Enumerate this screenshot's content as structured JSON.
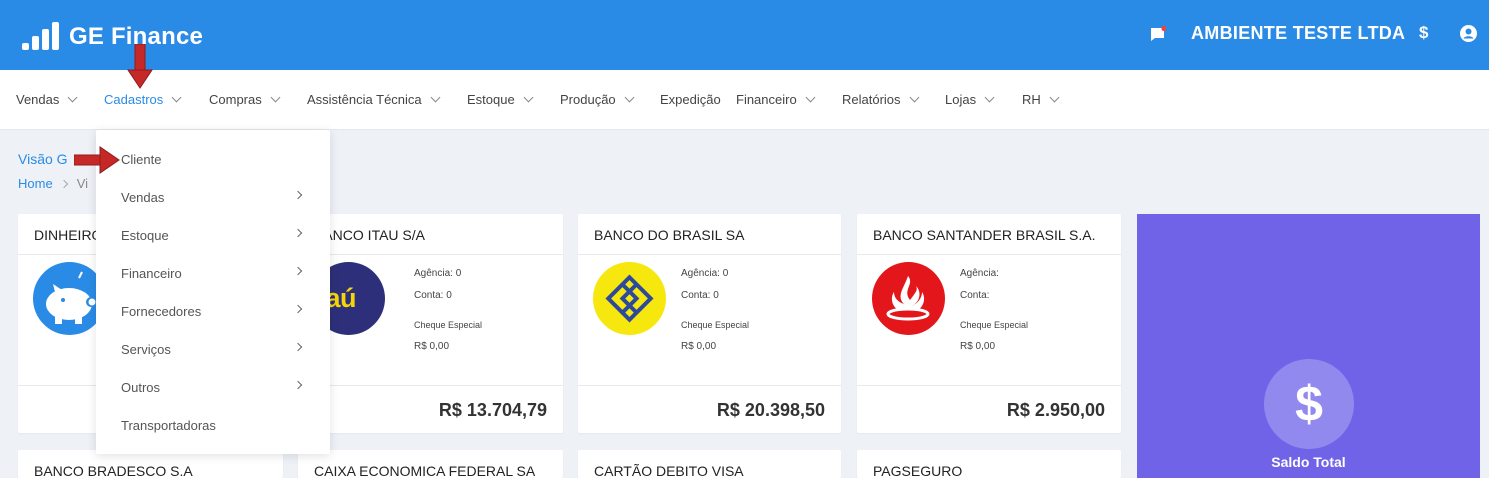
{
  "header": {
    "app_name": "GE Finance",
    "company": "AMBIENTE TESTE LTDA",
    "currency_symbol": "$",
    "icons": [
      "logo-bars-icon",
      "chat-notification-icon",
      "dollar-icon",
      "user-icon"
    ],
    "colors": {
      "bar": "#2a8be6",
      "notification_dot": "#f44336"
    }
  },
  "menu": {
    "items": [
      {
        "label": "Vendas",
        "has_dropdown": true
      },
      {
        "label": "Cadastros",
        "has_dropdown": true,
        "active": true
      },
      {
        "label": "Compras",
        "has_dropdown": true
      },
      {
        "label": "Assistência Técnica",
        "has_dropdown": true
      },
      {
        "label": "Estoque",
        "has_dropdown": true
      },
      {
        "label": "Produção",
        "has_dropdown": true
      },
      {
        "label": "Expedição",
        "has_dropdown": false
      },
      {
        "label": "Financeiro",
        "has_dropdown": true
      },
      {
        "label": "Relatórios",
        "has_dropdown": true
      },
      {
        "label": "Lojas",
        "has_dropdown": true
      },
      {
        "label": "RH",
        "has_dropdown": true
      }
    ]
  },
  "dropdown": {
    "items": [
      {
        "label": "Cliente",
        "has_submenu": false
      },
      {
        "label": "Vendas",
        "has_submenu": true
      },
      {
        "label": "Estoque",
        "has_submenu": true
      },
      {
        "label": "Financeiro",
        "has_submenu": true
      },
      {
        "label": "Fornecedores",
        "has_submenu": true
      },
      {
        "label": "Serviços",
        "has_submenu": true
      },
      {
        "label": "Outros",
        "has_submenu": true
      },
      {
        "label": "Transportadoras",
        "has_submenu": false
      }
    ]
  },
  "page": {
    "title": "Visão G",
    "breadcrumb_home": "Home",
    "breadcrumb_current": "Vi"
  },
  "cards": [
    {
      "name": "DINHEIRO",
      "logo": "piggy-bank-icon",
      "agencia": "",
      "conta": "",
      "cheque_label": "",
      "cheque_value": "",
      "total": ""
    },
    {
      "name": "BANCO ITAU S/A",
      "logo": "itau-logo",
      "logo_text": "itaú",
      "agencia": "Agência: 0",
      "conta": "Conta: 0",
      "cheque_label": "Cheque Especial",
      "cheque_value": "R$ 0,00",
      "total": "R$ 13.704,79"
    },
    {
      "name": "BANCO DO BRASIL SA",
      "logo": "banco-do-brasil-logo",
      "agencia": "Agência: 0",
      "conta": "Conta: 0",
      "cheque_label": "Cheque Especial",
      "cheque_value": "R$ 0,00",
      "total": "R$ 20.398,50"
    },
    {
      "name": "BANCO SANTANDER BRASIL S.A.",
      "logo": "santander-flame-logo",
      "agencia": "Agência:",
      "conta": "Conta:",
      "cheque_label": "Cheque Especial",
      "cheque_value": "R$ 0,00",
      "total": "R$ 2.950,00"
    }
  ],
  "cards_row2": [
    {
      "name": "BANCO BRADESCO S.A"
    },
    {
      "name": "CAIXA ECONOMICA FEDERAL SA"
    },
    {
      "name": "CARTÃO DEBITO VISA"
    },
    {
      "name": "PAGSEGURO"
    }
  ],
  "saldo": {
    "icon": "dollar-circle-icon",
    "symbol": "$",
    "label": "Saldo Total",
    "color": "#7063e8"
  }
}
